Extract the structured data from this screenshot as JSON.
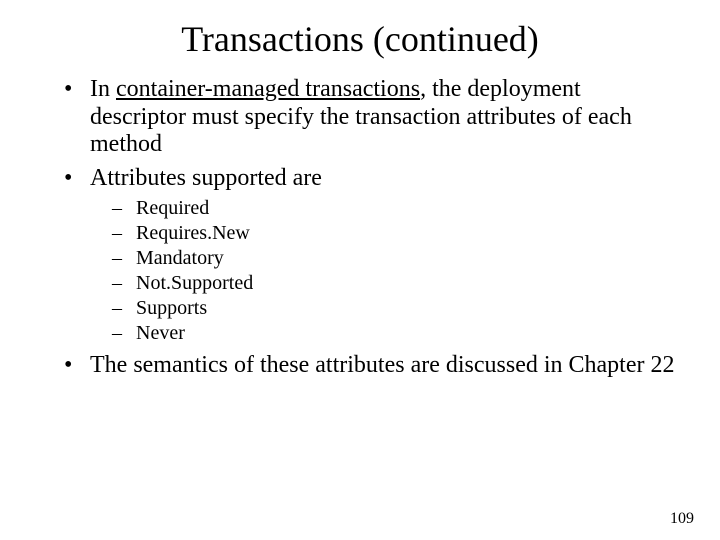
{
  "title": "Transactions  (continued)",
  "bullets": {
    "b0_pre": "In ",
    "b0_underline": "container-managed transactions",
    "b0_post": ", the deployment descriptor must specify the transaction attributes of each method",
    "b1": "Attributes supported are",
    "b2": "The semantics of these attributes are discussed in Chapter 22"
  },
  "attributes": {
    "a0": "Required",
    "a1": "Requires.New",
    "a2": "Mandatory",
    "a3": "Not.Supported",
    "a4": "Supports",
    "a5": "Never"
  },
  "page_number": "109"
}
